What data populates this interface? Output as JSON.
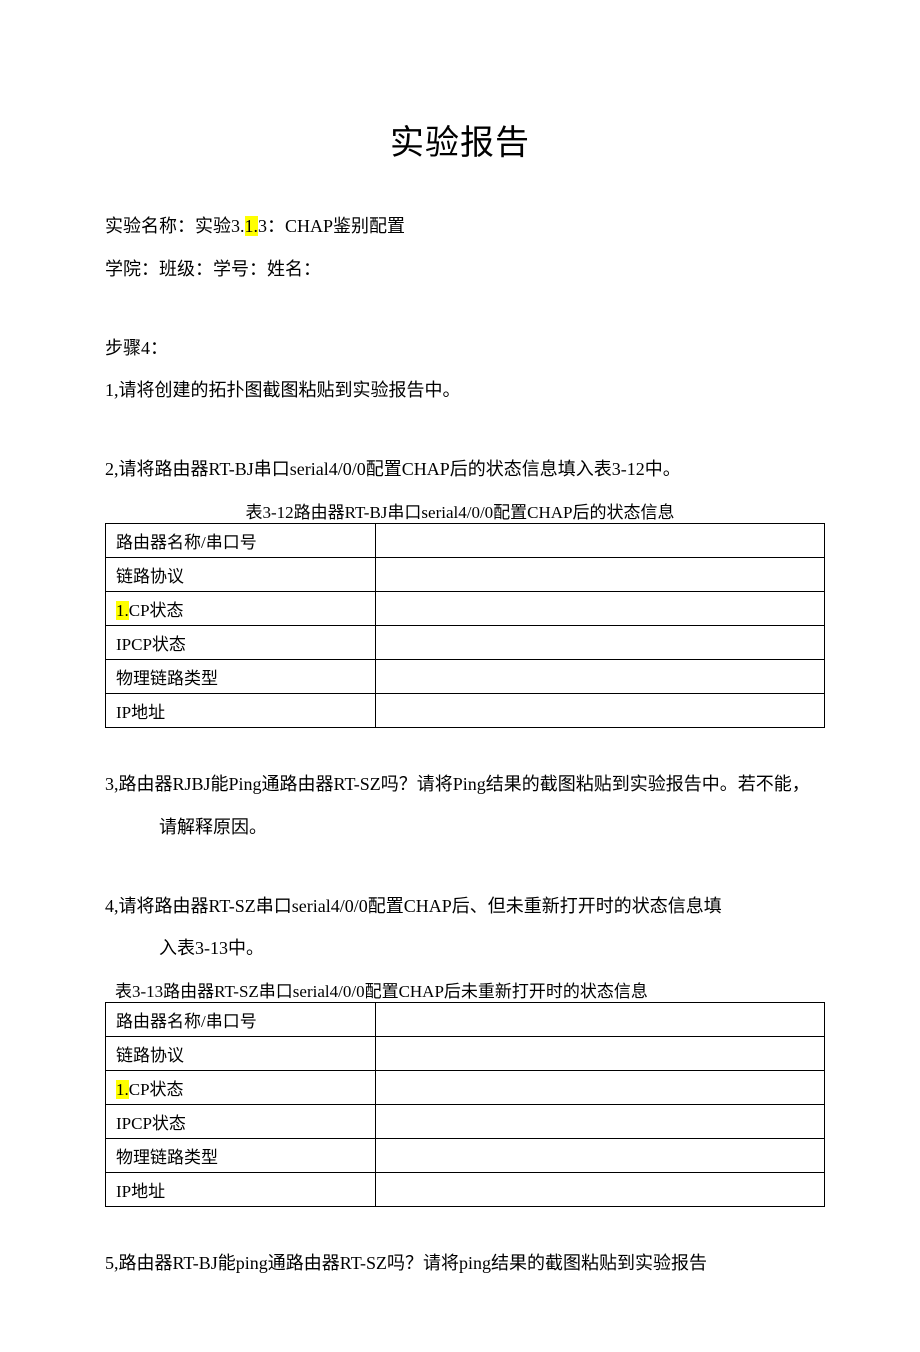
{
  "title": "实验报告",
  "exp": {
    "prefix": "实验名称：实验3.",
    "hl": "1.",
    "suffix": "3：CHAP鉴别配置"
  },
  "info_line": "学院：班级：学号：姓名：",
  "step4": "步骤4：",
  "q1": "1,请将创建的拓扑图截图粘贴到实验报告中。",
  "q2": "2,请将路由器RT-BJ串口serial4/0/0配置CHAP后的状态信息填入表3-12中。",
  "table1": {
    "caption": "表3-12路由器RT-BJ串口serial4/0/0配置CHAP后的状态信息",
    "rows": [
      {
        "label_pre": "路由器名称/串口号",
        "hl": "",
        "label_post": "",
        "val": ""
      },
      {
        "label_pre": "链路协议",
        "hl": "",
        "label_post": "",
        "val": ""
      },
      {
        "label_pre": "",
        "hl": "1.",
        "label_post": "CP状态",
        "val": ""
      },
      {
        "label_pre": "IPCP状态",
        "hl": "",
        "label_post": "",
        "val": ""
      },
      {
        "label_pre": "物理链路类型",
        "hl": "",
        "label_post": "",
        "val": ""
      },
      {
        "label_pre": "IP地址",
        "hl": "",
        "label_post": "",
        "val": ""
      }
    ]
  },
  "q3_a": "3,路由器RJBJ能Ping通路由器RT-SZ吗？请将Ping结果的截图粘贴到实验报告中。若不能，",
  "q3_b": "请解释原因。",
  "q4_a": "4,请将路由器RT-SZ串口serial4/0/0配置CHAP后、但未重新打开时的状态信息填",
  "q4_b": "入表3-13中。",
  "table2": {
    "caption": "表3-13路由器RT-SZ串口serial4/0/0配置CHAP后未重新打开时的状态信息",
    "rows": [
      {
        "label_pre": "路由器名称/串口号",
        "hl": "",
        "label_post": "",
        "val": ""
      },
      {
        "label_pre": "链路协议",
        "hl": "",
        "label_post": "",
        "val": ""
      },
      {
        "label_pre": "",
        "hl": "1.",
        "label_post": "CP状态",
        "val": ""
      },
      {
        "label_pre": "IPCP状态",
        "hl": "",
        "label_post": "",
        "val": ""
      },
      {
        "label_pre": "物理链路类型",
        "hl": "",
        "label_post": "",
        "val": ""
      },
      {
        "label_pre": "IP地址",
        "hl": "",
        "label_post": "",
        "val": ""
      }
    ]
  },
  "q5": "5,路由器RT-BJ能ping通路由器RT-SZ吗？请将ping结果的截图粘贴到实验报告"
}
